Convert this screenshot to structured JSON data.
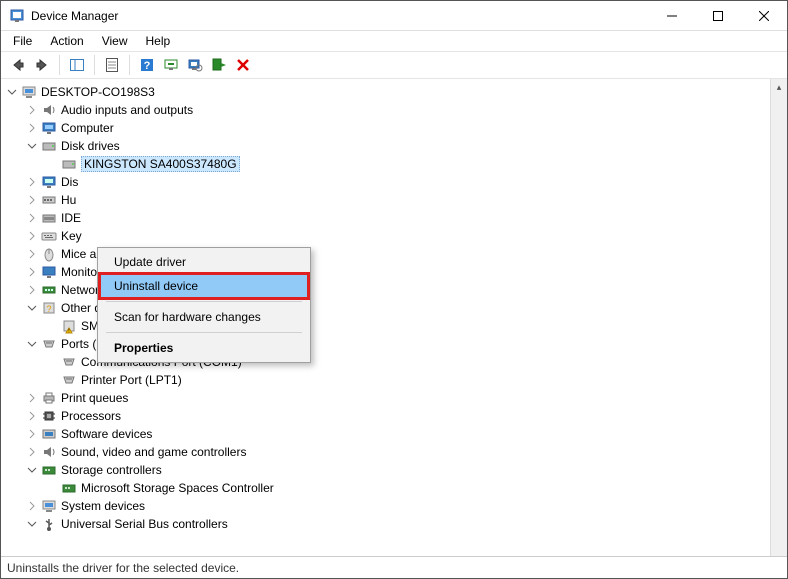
{
  "window": {
    "title": "Device Manager"
  },
  "menu": {
    "file": "File",
    "action": "Action",
    "view": "View",
    "help": "Help"
  },
  "status": "Uninstalls the driver for the selected device.",
  "context_menu": {
    "update": "Update driver",
    "uninstall": "Uninstall device",
    "scan": "Scan for hardware changes",
    "properties": "Properties"
  },
  "tree": {
    "root": "DESKTOP-CO198S3",
    "audio": "Audio inputs and outputs",
    "computer": "Computer",
    "disk_drives": "Disk drives",
    "disk_drive_item": "KINGSTON SA400S37480G",
    "display_adapters_short": "Dis",
    "hid_short": "Hu",
    "ide": "IDE",
    "keyboards_short": "Key",
    "mice": "Mice and other pointing devices",
    "monitors": "Monitors",
    "network": "Network adapters",
    "other_devices": "Other devices",
    "sm_bus": "SM Bus Controller",
    "ports": "Ports (COM & LPT)",
    "com1": "Communications Port (COM1)",
    "lpt1": "Printer Port (LPT1)",
    "print_queues": "Print queues",
    "processors": "Processors",
    "software_devices": "Software devices",
    "sound_controllers": "Sound, video and game controllers",
    "storage_controllers": "Storage controllers",
    "ms_storage": "Microsoft Storage Spaces Controller",
    "system_devices": "System devices",
    "usb_controllers": "Universal Serial Bus controllers"
  }
}
